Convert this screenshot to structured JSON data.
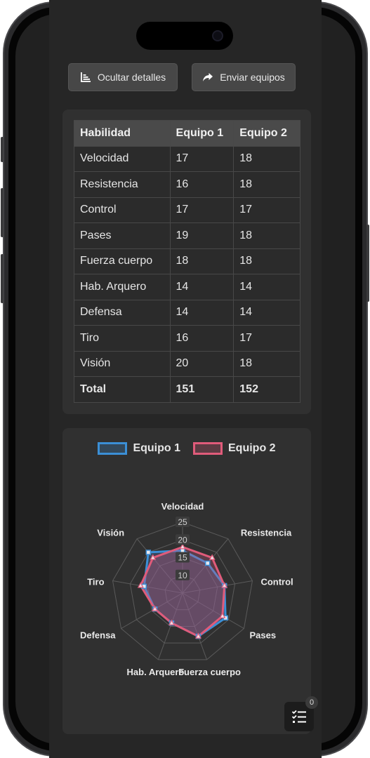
{
  "actions": {
    "hide_details_label": "Ocultar detalles",
    "send_teams_label": "Enviar equipos"
  },
  "table": {
    "headers": [
      "Habilidad",
      "Equipo 1",
      "Equipo 2"
    ],
    "rows": [
      [
        "Velocidad",
        "17",
        "18"
      ],
      [
        "Resistencia",
        "16",
        "18"
      ],
      [
        "Control",
        "17",
        "17"
      ],
      [
        "Pases",
        "19",
        "18"
      ],
      [
        "Fuerza cuerpo",
        "18",
        "18"
      ],
      [
        "Hab. Arquero",
        "14",
        "14"
      ],
      [
        "Defensa",
        "14",
        "14"
      ],
      [
        "Tiro",
        "16",
        "17"
      ],
      [
        "Visión",
        "20",
        "18"
      ]
    ],
    "total": [
      "Total",
      "151",
      "152"
    ]
  },
  "chart_data": {
    "type": "radar",
    "categories": [
      "Velocidad",
      "Resistencia",
      "Control",
      "Pases",
      "Fuerza cuerpo",
      "Hab. Arquero",
      "Defensa",
      "Tiro",
      "Visión"
    ],
    "series": [
      {
        "name": "Equipo 1",
        "values": [
          17,
          16,
          17,
          19,
          18,
          14,
          14,
          16,
          20
        ],
        "color": "#3b8fd6"
      },
      {
        "name": "Equipo 2",
        "values": [
          18,
          18,
          17,
          18,
          18,
          14,
          14,
          17,
          18
        ],
        "color": "#e05b7a"
      }
    ],
    "r_ticks": [
      "10",
      "15",
      "20",
      "25"
    ],
    "r_range": [
      5,
      25
    ],
    "legend_position": "top"
  },
  "fab": {
    "icon": "checklist-icon",
    "badge": "0"
  },
  "colors": {
    "background": "#212121",
    "card": "#303030",
    "button": "#474747"
  }
}
